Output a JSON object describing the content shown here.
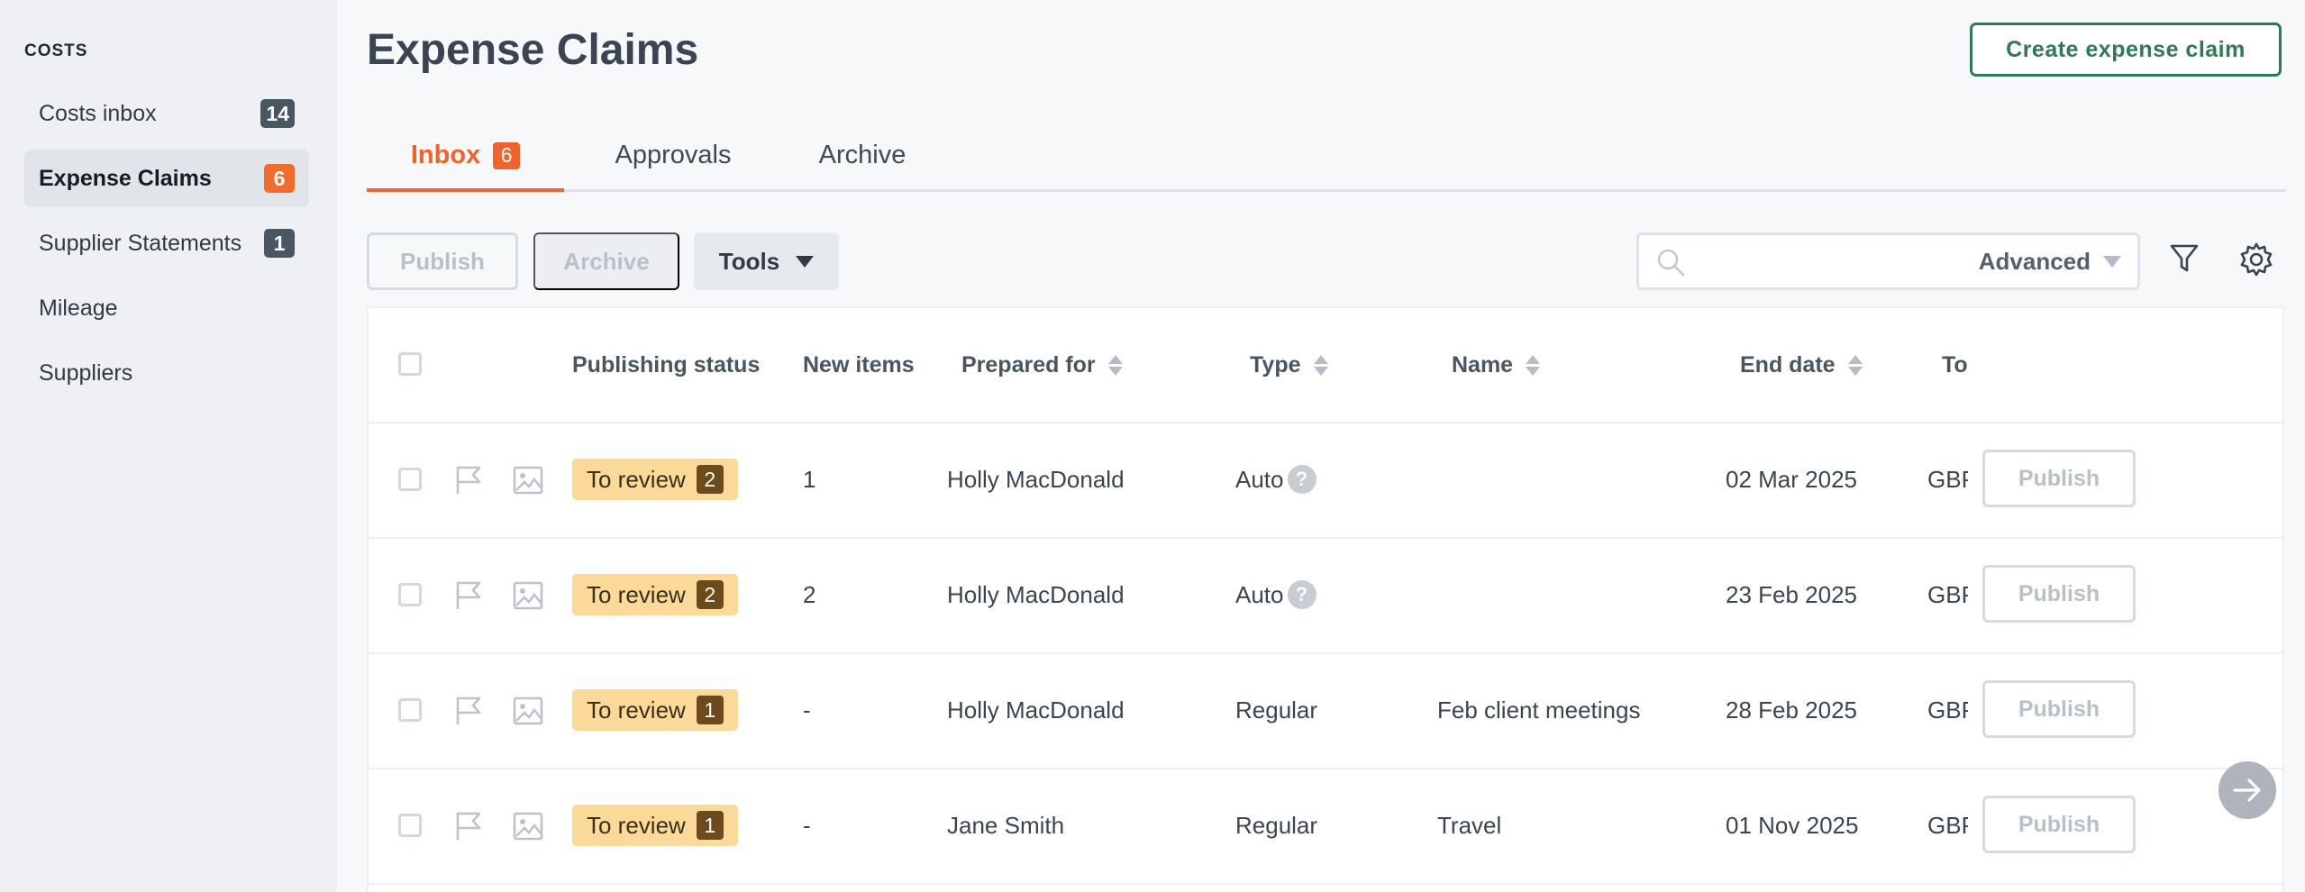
{
  "sidebar": {
    "heading": "COSTS",
    "items": [
      {
        "label": "Costs inbox",
        "badge": "14"
      },
      {
        "label": "Expense Claims",
        "badge": "6"
      },
      {
        "label": "Supplier Statements",
        "badge": "1"
      },
      {
        "label": "Mileage"
      },
      {
        "label": "Suppliers"
      }
    ]
  },
  "header": {
    "title": "Expense Claims",
    "create_button": "Create expense claim"
  },
  "tabs": [
    {
      "label": "Inbox",
      "badge": "6"
    },
    {
      "label": "Approvals"
    },
    {
      "label": "Archive"
    }
  ],
  "toolbar": {
    "publish_label": "Publish",
    "archive_label": "Archive",
    "tools_label": "Tools",
    "search_placeholder": "",
    "advanced_label": "Advanced"
  },
  "table": {
    "columns": {
      "publishing_status": "Publishing status",
      "new_items": "New items",
      "prepared_for": "Prepared for",
      "type": "Type",
      "name": "Name",
      "end_date": "End date",
      "total": "To"
    },
    "rows": [
      {
        "status": "To review",
        "status_count": "2",
        "new_items": "1",
        "prepared_for": "Holly MacDonald",
        "type": "Auto",
        "name": "",
        "end_date": "02 Mar 2025",
        "total": "GBP",
        "publish": "Publish"
      },
      {
        "status": "To review",
        "status_count": "2",
        "new_items": "2",
        "prepared_for": "Holly MacDonald",
        "type": "Auto",
        "name": "",
        "end_date": "23 Feb 2025",
        "total": "GBP",
        "publish": "Publish"
      },
      {
        "status": "To review",
        "status_count": "1",
        "new_items": "-",
        "prepared_for": "Holly MacDonald",
        "type": "Regular",
        "name": "Feb client meetings",
        "end_date": "28 Feb 2025",
        "total": "GBP",
        "publish": "Publish"
      },
      {
        "status": "To review",
        "status_count": "1",
        "new_items": "-",
        "prepared_for": "Jane Smith",
        "type": "Regular",
        "name": "Travel",
        "end_date": "01 Nov 2025",
        "total": "GBP",
        "publish": "Publish"
      }
    ]
  },
  "icons": {
    "help": "?",
    "flag": "flag-icon",
    "image": "image-icon",
    "search": "search-icon",
    "filter": "filter-icon",
    "settings": "gear-icon",
    "scroll": "arrow-right-icon"
  },
  "colors": {
    "accent": "#f0632a",
    "brand_green": "#2f7a55",
    "status_bg": "#fad999"
  }
}
